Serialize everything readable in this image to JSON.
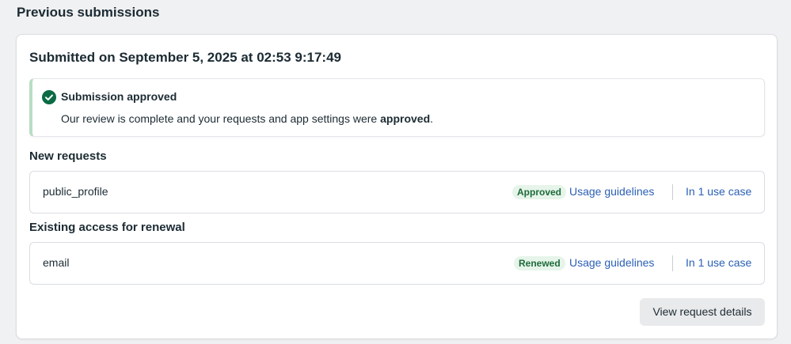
{
  "section_title": "Previous submissions",
  "submission": {
    "title": "Submitted on September 5, 2025 at 02:53 9:17:49",
    "banner": {
      "title": "Submission approved",
      "text_before": "Our review is complete and your requests and app settings were ",
      "text_bold": "approved",
      "text_after": ".",
      "status_color": "#0a7c4a"
    },
    "new_requests": {
      "label": "New requests",
      "items": [
        {
          "name": "public_profile",
          "badge": "Approved",
          "guidelines_link": "Usage guidelines",
          "use_case_link": "In 1 use case"
        }
      ]
    },
    "existing_access": {
      "label": "Existing access for renewal",
      "items": [
        {
          "name": "email",
          "badge": "Renewed",
          "guidelines_link": "Usage guidelines",
          "use_case_link": "In 1 use case"
        }
      ]
    },
    "view_details_button": "View request details"
  },
  "icons": {
    "banner_icon": "check-circle-icon"
  }
}
